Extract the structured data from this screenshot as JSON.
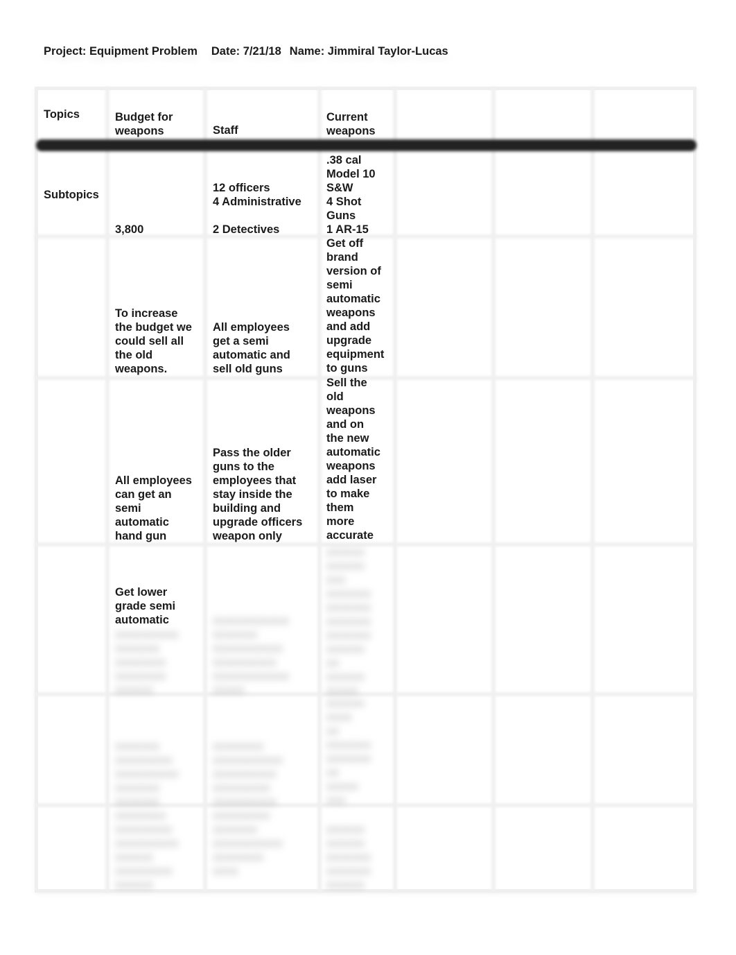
{
  "header": {
    "project": "Project: Equipment Problem",
    "date": "Date: 7/21/18",
    "name": "Name: Jimmiral Taylor-Lucas"
  },
  "table": {
    "columns": [
      "Topics",
      " Budget for\nweapons",
      "Staff",
      "Current\nweapons",
      "",
      "",
      ""
    ],
    "rows": [
      {
        "label": "Subtopics",
        "budget": " \n\n\n\n\n3,800",
        "staff": " 12 officers\n4 Administrative\n\n2 Detectives",
        "current": " .38 cal\nModel 10\nS&W\n4 Shot\nGuns\n1 AR-15"
      },
      {
        "label": "",
        "budget": " To increase\nthe budget we\ncould sell all\nthe old\nweapons.",
        "staff": " All employees\nget a semi\nautomatic and\nsell old guns",
        "current": " Get off\nbrand\nversion of\nsemi\nautomatic\nweapons\nand add\nupgrade\nequipment\nto guns"
      },
      {
        "label": "",
        "budget": " All employees\ncan get an\nsemi\nautomatic\nhand gun",
        "staff": " Pass the older\nguns to the\nemployees that\nstay inside the\nbuilding and\nupgrade officers\nweapon only",
        "current": " Sell the\nold\nweapons\nand  on\nthe new\nautomatic\nweapons\nadd laser\nto make\nthem\nmore\naccurate"
      },
      {
        "label": "",
        "budget": " Get lower\ngrade semi\nautomatic",
        "budget_hidden": "xxxxxxxxxx\nxxxxxxx\nxxxxxxxx\nxxxxxxxx\nxxxxxx",
        "staff_hidden": "xxxxxxxxxxxx\nxxxxxxx\nxxxxxxxxxxx\nxxxxxxxxxx\nxxxxxxxxxxxx\nxxxxx",
        "current_hidden": "xxxxxx\nxxxxxx\nxxx\nxxxxxxx\nxxxxxxx\nxxxxxxx\nxxxxxxx\nxxxxxx\nxx\nxxxxxx\nxxxxx"
      },
      {
        "label": "",
        "budget_hidden": "xxxxxxx\nxxxxxxxxx\nxxxxxxxxxx\nxxxxxxx\nxxxxxxx",
        "staff_hidden": "xxxxxxxx\nxxxxxxxxxxx\nxxxxxxxxxx\nxxxxxxxxx\nxxxxxxxxxx",
        "current_hidden": "xxxxxx\nxxxx\nxx\nxxxxxxx\nxxxxxxx\nxx\nxxxxx\nxxx"
      },
      {
        "label": "",
        "budget_hidden": "xxxxxxxx\nxxxxxxxxx\nxxxxxxxxxx\nxxxxxx\nxxxxxxxxx\nxxxxxx",
        "staff_hidden": "xxxxxxxxx\nxxxxxxx\nxxxxxxxxxxx\nxxxxxxxx\nxxxx",
        "current_hidden": "xxxxxx\nxxxxxx\nxxxxxxx\nxxxxxxx\nxxxxxx"
      }
    ]
  }
}
